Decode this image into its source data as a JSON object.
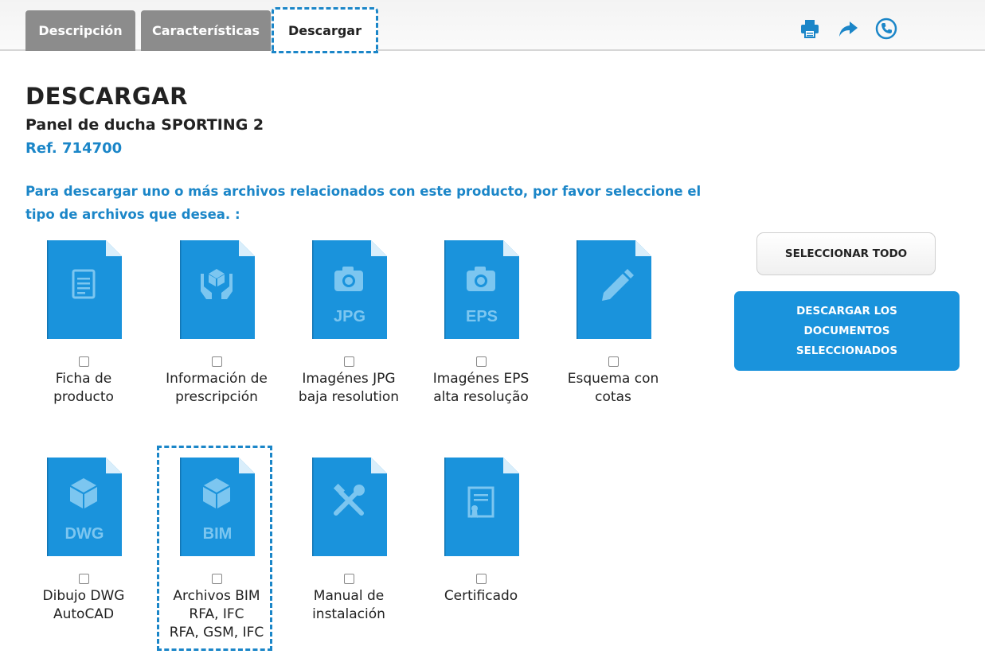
{
  "tabs": [
    {
      "label": "Descripción",
      "active": false
    },
    {
      "label": "Características",
      "active": false
    },
    {
      "label": "Descargar",
      "active": true
    }
  ],
  "toolbar_icons": [
    "printer-icon",
    "share-icon",
    "phone-icon"
  ],
  "page": {
    "title": "DESCARGAR",
    "product": "Panel de ducha SPORTING 2",
    "reference": "Ref. 714700",
    "instructions": "Para descargar uno o más archivos relacionados con este producto, por favor seleccione el tipo de archivos que desea. :"
  },
  "files": [
    {
      "icon": "document-icon",
      "badge": "",
      "label_lines": [
        "Ficha de",
        "producto"
      ]
    },
    {
      "icon": "hands-box-icon",
      "badge": "",
      "label_lines": [
        "Información de",
        "prescripción"
      ]
    },
    {
      "icon": "camera-icon",
      "badge": "JPG",
      "label_lines": [
        "Imagénes JPG",
        "baja resolution"
      ]
    },
    {
      "icon": "camera-icon",
      "badge": "EPS",
      "label_lines": [
        "Imagénes EPS",
        "alta resolução"
      ]
    },
    {
      "icon": "pencil-icon",
      "badge": "",
      "label_lines": [
        "Esquema con",
        "cotas"
      ]
    },
    {
      "icon": "cube-icon",
      "badge": "DWG",
      "label_lines": [
        "Dibujo DWG",
        "AutoCAD"
      ]
    },
    {
      "icon": "cube-icon",
      "badge": "BIM",
      "label_lines": [
        "Archivos BIM",
        "RFA, IFC",
        "RFA, GSM, IFC"
      ]
    },
    {
      "icon": "tools-icon",
      "badge": "",
      "label_lines": [
        "Manual de",
        "instalación"
      ]
    },
    {
      "icon": "certificate-icon",
      "badge": "",
      "label_lines": [
        "Certificado"
      ]
    }
  ],
  "buttons": {
    "select_all": "SELECCIONAR TODO",
    "download_selected": "DESCARGAR LOS DOCUMENTOS SELECCIONADOS"
  },
  "colors": {
    "accent": "#1b86c8",
    "file_icon": "#1a93dc",
    "tab_inactive": "#8c8c8c"
  }
}
